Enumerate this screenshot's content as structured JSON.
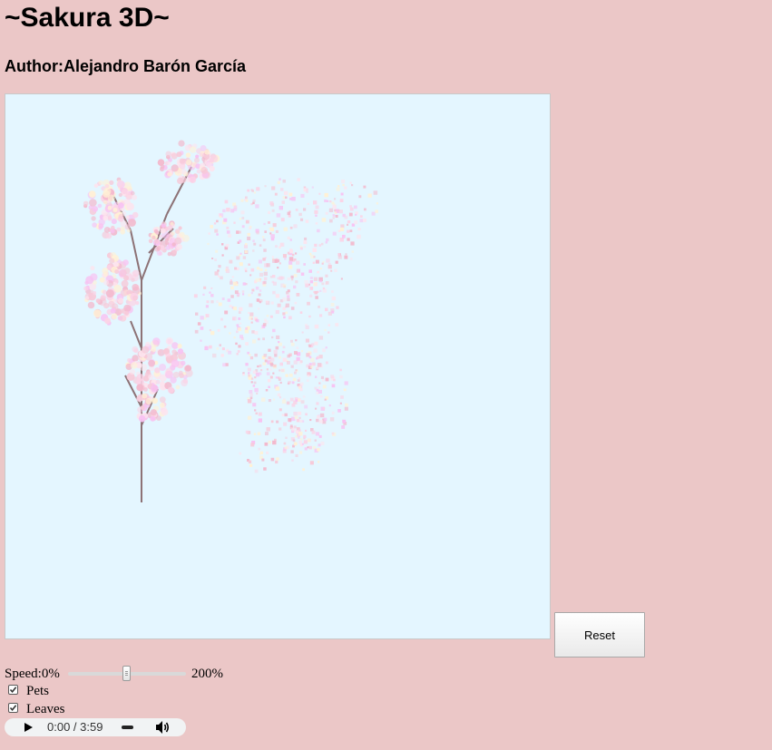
{
  "page": {
    "title": "~Sakura 3D~",
    "author": "Author:Alejandro Barón García"
  },
  "canvas": {
    "background": "#e4f6ff",
    "blossom_colors": [
      "#f7c9d8",
      "#fbd3e6",
      "#f3b8cc",
      "#fde4ee",
      "#fff1d6",
      "#f8c2f2"
    ],
    "branch_color": "#8d7276"
  },
  "controls": {
    "reset_label": "Reset",
    "speed": {
      "min_label": "Speed:0%",
      "max_label": "200%",
      "value_fraction": 0.5
    },
    "pets": {
      "label": "Pets",
      "checked": true
    },
    "leaves": {
      "label": "Leaves",
      "checked": true
    }
  },
  "audio": {
    "time_display": "0:00 / 3:59",
    "playing": false,
    "icons": [
      "play-icon",
      "volume-icon"
    ]
  }
}
